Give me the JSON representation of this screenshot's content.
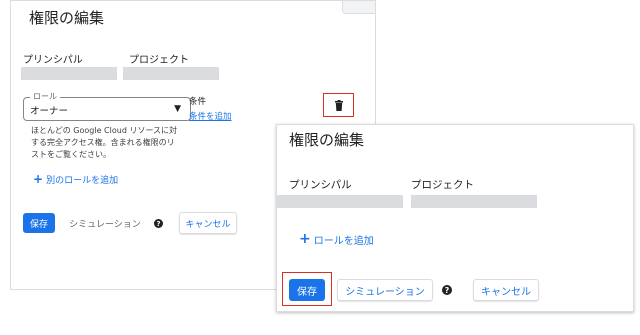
{
  "back": {
    "title": "権限の編集",
    "principal_header": "プリンシパル",
    "project_header": "プロジェクト",
    "role_label": "ロール",
    "role_value": "オーナー",
    "condition_label": "条件",
    "add_condition_link": "条件を追加",
    "role_help_text": "ほとんどの Google Cloud リソースに対する完全アクセス権。含まれる権限のリストをご覧ください。",
    "add_another_role": "別のロールを追加",
    "save_label": "保存",
    "simulation_label": "シミュレーション",
    "help_glyph": "?",
    "cancel_label": "キャンセル"
  },
  "front": {
    "title": "権限の編集",
    "principal_header": "プリンシパル",
    "project_header": "プロジェクト",
    "add_role": "ロールを追加",
    "save_label": "保存",
    "simulation_label": "シミュレーション",
    "help_glyph": "?",
    "cancel_label": "キャンセル"
  },
  "icons": {
    "plus": "+",
    "dropdown": "▼",
    "trash": "trash-icon"
  },
  "colors": {
    "accent": "#1a73e8",
    "highlight": "#d93025",
    "placeholder": "#dadce0"
  }
}
